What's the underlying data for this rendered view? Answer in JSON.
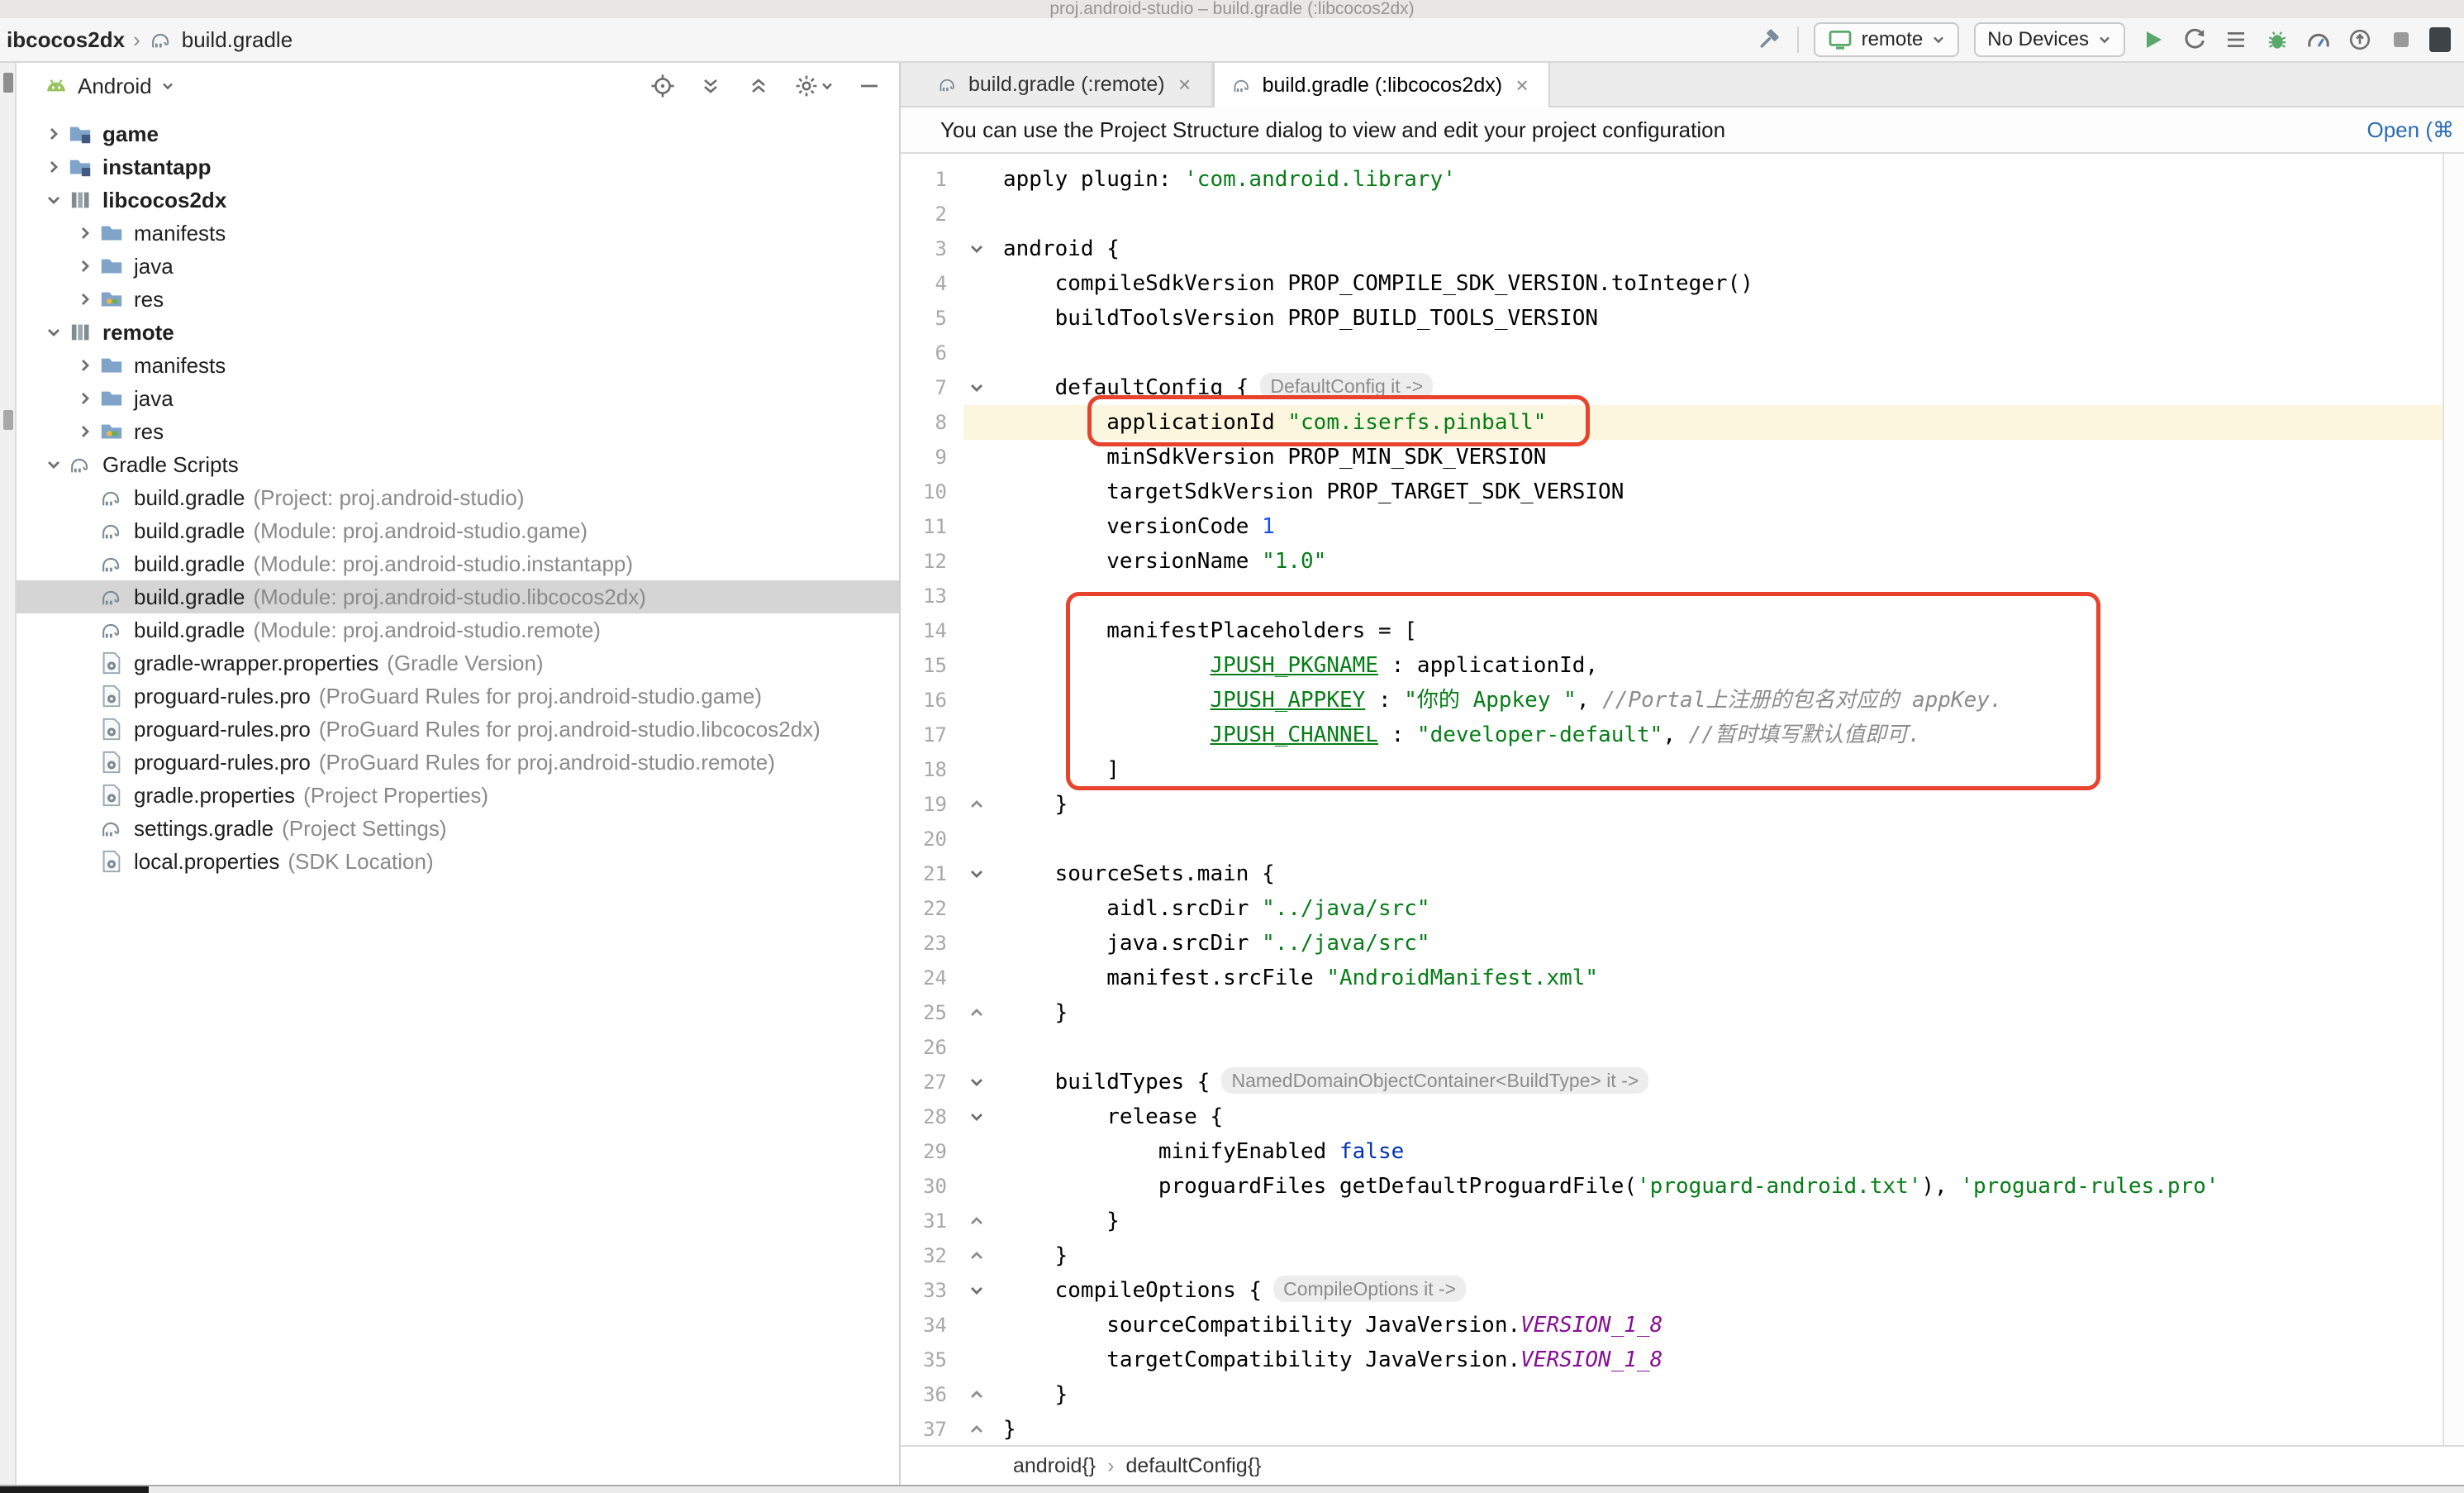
{
  "window": {
    "title": "proj.android-studio – build.gradle (:libcocos2dx)",
    "breadcrumb": {
      "module": "ibcocos2dx",
      "file": "build.gradle"
    },
    "toolbar": {
      "run_config": "remote",
      "devices": "No Devices"
    }
  },
  "project_panel": {
    "view_selector": "Android",
    "tree": [
      {
        "indent": 0,
        "chevron": "right",
        "icon": "folder-module",
        "name": "game",
        "bold": true
      },
      {
        "indent": 0,
        "chevron": "right",
        "icon": "folder-module",
        "name": "instantapp",
        "bold": true
      },
      {
        "indent": 0,
        "chevron": "down",
        "icon": "module-lib",
        "name": "libcocos2dx",
        "bold": true
      },
      {
        "indent": 1,
        "chevron": "right",
        "icon": "folder",
        "name": "manifests"
      },
      {
        "indent": 1,
        "chevron": "right",
        "icon": "folder",
        "name": "java"
      },
      {
        "indent": 1,
        "chevron": "right",
        "icon": "folder-res",
        "name": "res"
      },
      {
        "indent": 0,
        "chevron": "down",
        "icon": "module-lib",
        "name": "remote",
        "bold": true
      },
      {
        "indent": 1,
        "chevron": "right",
        "icon": "folder",
        "name": "manifests"
      },
      {
        "indent": 1,
        "chevron": "right",
        "icon": "folder",
        "name": "java"
      },
      {
        "indent": 1,
        "chevron": "right",
        "icon": "folder-res",
        "name": "res"
      },
      {
        "indent": 0,
        "chevron": "down",
        "icon": "gradle",
        "name": "Gradle Scripts"
      },
      {
        "indent": 1,
        "icon": "gradle",
        "name": "build.gradle",
        "meta": "(Project: proj.android-studio)"
      },
      {
        "indent": 1,
        "icon": "gradle",
        "name": "build.gradle",
        "meta": "(Module: proj.android-studio.game)"
      },
      {
        "indent": 1,
        "icon": "gradle",
        "name": "build.gradle",
        "meta": "(Module: proj.android-studio.instantapp)"
      },
      {
        "indent": 1,
        "icon": "gradle",
        "name": "build.gradle",
        "meta": "(Module: proj.android-studio.libcocos2dx)",
        "selected": true
      },
      {
        "indent": 1,
        "icon": "gradle",
        "name": "build.gradle",
        "meta": "(Module: proj.android-studio.remote)"
      },
      {
        "indent": 1,
        "icon": "file-gear",
        "name": "gradle-wrapper.properties",
        "meta": "(Gradle Version)"
      },
      {
        "indent": 1,
        "icon": "file-gear",
        "name": "proguard-rules.pro",
        "meta": "(ProGuard Rules for proj.android-studio.game)"
      },
      {
        "indent": 1,
        "icon": "file-gear",
        "name": "proguard-rules.pro",
        "meta": "(ProGuard Rules for proj.android-studio.libcocos2dx)"
      },
      {
        "indent": 1,
        "icon": "file-gear",
        "name": "proguard-rules.pro",
        "meta": "(ProGuard Rules for proj.android-studio.remote)"
      },
      {
        "indent": 1,
        "icon": "file-gear",
        "name": "gradle.properties",
        "meta": "(Project Properties)"
      },
      {
        "indent": 1,
        "icon": "gradle",
        "name": "settings.gradle",
        "meta": "(Project Settings)"
      },
      {
        "indent": 1,
        "icon": "file-gear",
        "name": "local.properties",
        "meta": "(SDK Location)"
      }
    ]
  },
  "editor": {
    "tabs": [
      {
        "label": "build.gradle (:remote)"
      },
      {
        "label": "build.gradle (:libcocos2dx)"
      }
    ],
    "banner": {
      "text": "You can use the Project Structure dialog to view and edit your project configuration",
      "link": "Open (⌘"
    },
    "breadcrumbs_bottom": [
      "android{}",
      "defaultConfig{}"
    ],
    "annotations": [
      {
        "label": "applicationId-highlight",
        "color": "#E8432C"
      },
      {
        "label": "manifestPlaceholders-highlight",
        "color": "#E8432C"
      }
    ],
    "code": {
      "lines": [
        {
          "n": 1,
          "s": [
            [
              "p",
              "apply plugin: "
            ],
            [
              "s",
              "'com.android.library'"
            ]
          ]
        },
        {
          "n": 2,
          "s": []
        },
        {
          "n": 3,
          "fold": "open",
          "s": [
            [
              "p",
              "android {"
            ]
          ]
        },
        {
          "n": 4,
          "s": [
            [
              "p",
              "    compileSdkVersion PROP_COMPILE_SDK_VERSION.toInteger()"
            ]
          ]
        },
        {
          "n": 5,
          "s": [
            [
              "p",
              "    buildToolsVersion PROP_BUILD_TOOLS_VERSION"
            ]
          ]
        },
        {
          "n": 6,
          "s": []
        },
        {
          "n": 7,
          "fold": "open",
          "hint": "DefaultConfig it ->",
          "s": [
            [
              "p",
              "    defaultConfig {"
            ]
          ]
        },
        {
          "n": 8,
          "hl": true,
          "s": [
            [
              "p",
              "        applicationId "
            ],
            [
              "s",
              "\"com.iserfs.pinball\""
            ]
          ]
        },
        {
          "n": 9,
          "s": [
            [
              "p",
              "        minSdkVersion PROP_MIN_SDK_VERSION"
            ]
          ]
        },
        {
          "n": 10,
          "s": [
            [
              "p",
              "        targetSdkVersion PROP_TARGET_SDK_VERSION"
            ]
          ]
        },
        {
          "n": 11,
          "s": [
            [
              "p",
              "        versionCode "
            ],
            [
              "n",
              "1"
            ]
          ]
        },
        {
          "n": 12,
          "s": [
            [
              "p",
              "        versionName "
            ],
            [
              "s",
              "\"1.0\""
            ]
          ]
        },
        {
          "n": 13,
          "s": []
        },
        {
          "n": 14,
          "s": [
            [
              "p",
              "        manifestPlaceholders = ["
            ]
          ]
        },
        {
          "n": 15,
          "s": [
            [
              "p",
              "                "
            ],
            [
              "m",
              "JPUSH_PKGNAME"
            ],
            [
              "p",
              " : applicationId,"
            ]
          ]
        },
        {
          "n": 16,
          "s": [
            [
              "p",
              "                "
            ],
            [
              "m",
              "JPUSH_APPKEY"
            ],
            [
              "p",
              " : "
            ],
            [
              "s",
              "\"你的 Appkey \""
            ],
            [
              "p",
              ", "
            ],
            [
              "c",
              "//Portal上注册的包名对应的 appKey."
            ]
          ]
        },
        {
          "n": 17,
          "s": [
            [
              "p",
              "                "
            ],
            [
              "m",
              "JPUSH_CHANNEL"
            ],
            [
              "p",
              " : "
            ],
            [
              "s",
              "\"developer-default\""
            ],
            [
              "p",
              ", "
            ],
            [
              "c",
              "//暂时填写默认值即可."
            ]
          ]
        },
        {
          "n": 18,
          "s": [
            [
              "p",
              "        ]"
            ]
          ]
        },
        {
          "n": 19,
          "fold": "close",
          "s": [
            [
              "p",
              "    }"
            ]
          ]
        },
        {
          "n": 20,
          "s": []
        },
        {
          "n": 21,
          "fold": "open",
          "s": [
            [
              "p",
              "    sourceSets.main {"
            ]
          ]
        },
        {
          "n": 22,
          "s": [
            [
              "p",
              "        aidl.srcDir "
            ],
            [
              "s",
              "\"../java/src\""
            ]
          ]
        },
        {
          "n": 23,
          "s": [
            [
              "p",
              "        java.srcDir "
            ],
            [
              "s",
              "\"../java/src\""
            ]
          ]
        },
        {
          "n": 24,
          "s": [
            [
              "p",
              "        manifest.srcFile "
            ],
            [
              "s",
              "\"AndroidManifest.xml\""
            ]
          ]
        },
        {
          "n": 25,
          "fold": "close",
          "s": [
            [
              "p",
              "    }"
            ]
          ]
        },
        {
          "n": 26,
          "s": []
        },
        {
          "n": 27,
          "fold": "open",
          "hint": "NamedDomainObjectContainer<BuildType> it ->",
          "s": [
            [
              "p",
              "    buildTypes {"
            ]
          ]
        },
        {
          "n": 28,
          "fold": "open",
          "s": [
            [
              "p",
              "        release {"
            ]
          ]
        },
        {
          "n": 29,
          "s": [
            [
              "p",
              "            minifyEnabled "
            ],
            [
              "k",
              "false"
            ]
          ]
        },
        {
          "n": 30,
          "s": [
            [
              "p",
              "            proguardFiles getDefaultProguardFile("
            ],
            [
              "s",
              "'proguard-android.txt'"
            ],
            [
              "p",
              "), "
            ],
            [
              "s",
              "'proguard-rules.pro'"
            ]
          ]
        },
        {
          "n": 31,
          "fold": "close",
          "s": [
            [
              "p",
              "        }"
            ]
          ]
        },
        {
          "n": 32,
          "fold": "close",
          "s": [
            [
              "p",
              "    }"
            ]
          ]
        },
        {
          "n": 33,
          "fold": "open",
          "hint": "CompileOptions it ->",
          "s": [
            [
              "p",
              "    compileOptions {"
            ]
          ]
        },
        {
          "n": 34,
          "s": [
            [
              "p",
              "        sourceCompatibility JavaVersion."
            ],
            [
              "f",
              "VERSION_1_8"
            ]
          ]
        },
        {
          "n": 35,
          "s": [
            [
              "p",
              "        targetCompatibility JavaVersion."
            ],
            [
              "f",
              "VERSION_1_8"
            ]
          ]
        },
        {
          "n": 36,
          "fold": "close",
          "s": [
            [
              "p",
              "    }"
            ]
          ]
        },
        {
          "n": 37,
          "fold": "close",
          "s": [
            [
              "p",
              "}"
            ]
          ]
        }
      ]
    }
  }
}
